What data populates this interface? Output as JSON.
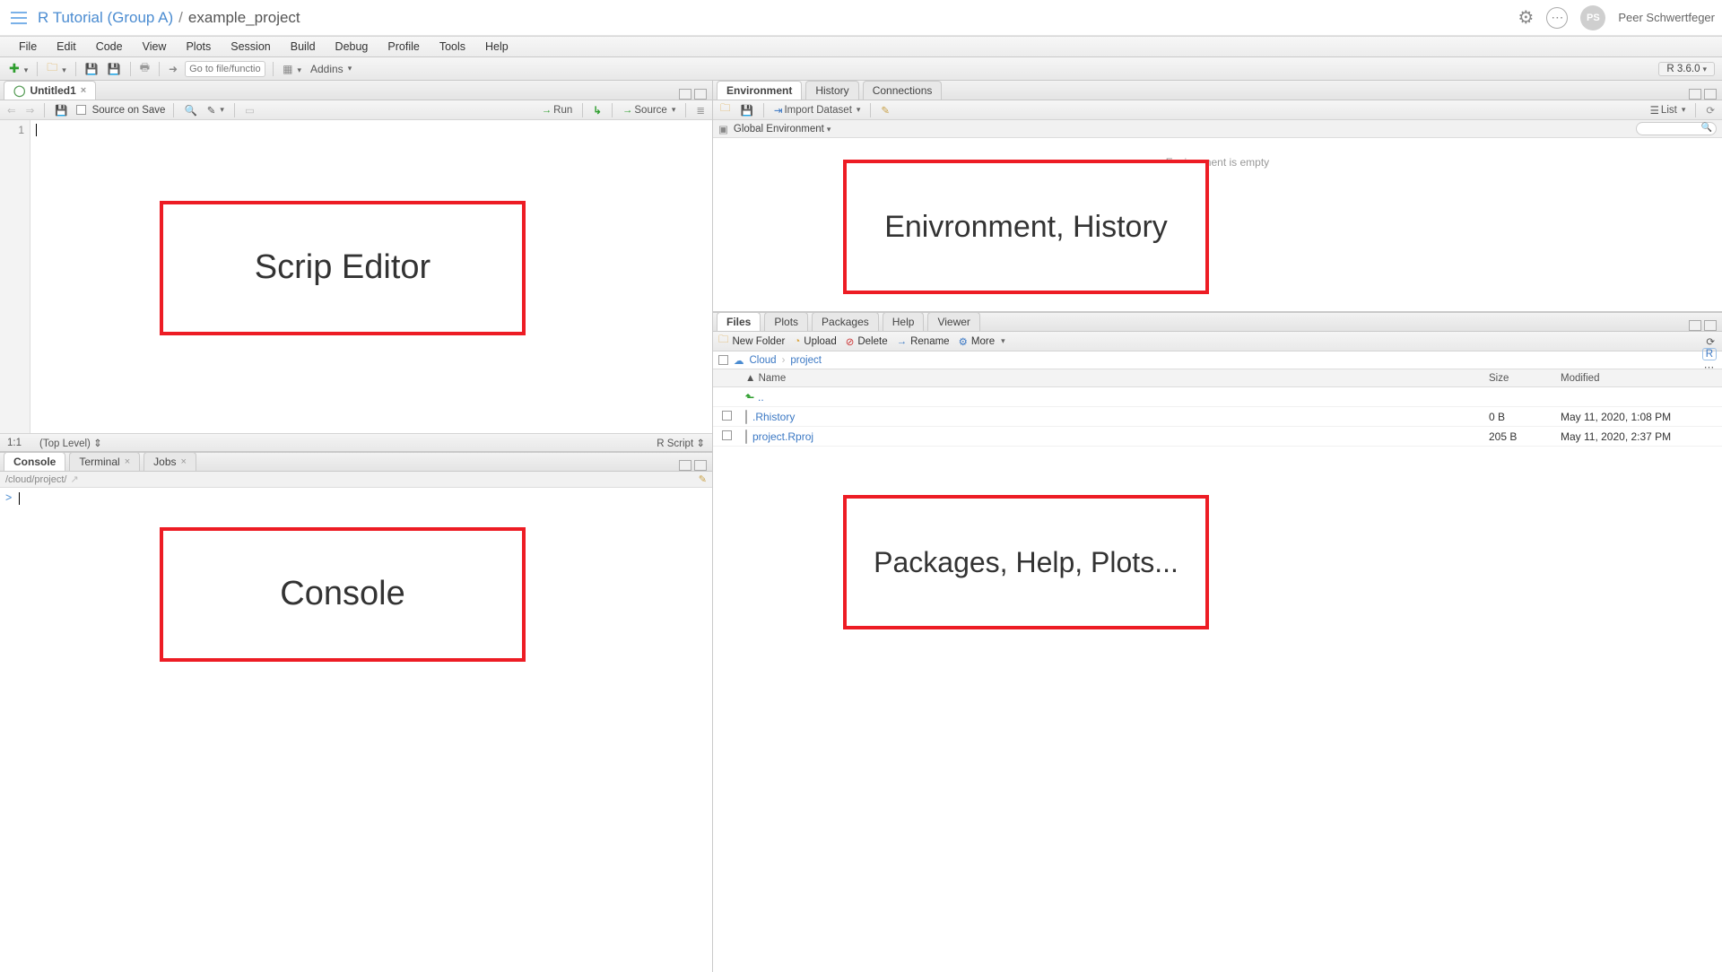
{
  "header": {
    "workspace_link": "R Tutorial (Group A)",
    "project_name": "example_project",
    "user_initials": "PS",
    "user_name": "Peer Schwertfeger"
  },
  "menus": [
    "File",
    "Edit",
    "Code",
    "View",
    "Plots",
    "Session",
    "Build",
    "Debug",
    "Profile",
    "Tools",
    "Help"
  ],
  "main_toolbar": {
    "go_placeholder": "Go to file/function",
    "addins_label": "Addins",
    "r_version": "R 3.6.0"
  },
  "editor": {
    "tab_title": "Untitled1",
    "source_on_save": "Source on Save",
    "run_label": "Run",
    "source_label": "Source",
    "line_number": "1",
    "cursor_pos": "1:1",
    "scope": "(Top Level)",
    "lang": "R Script",
    "annotation": "Scrip Editor"
  },
  "console": {
    "tabs": {
      "console": "Console",
      "terminal": "Terminal",
      "jobs": "Jobs"
    },
    "path": "/cloud/project/",
    "prompt": ">",
    "annotation": "Console"
  },
  "env": {
    "tabs": {
      "environment": "Environment",
      "history": "History",
      "connections": "Connections"
    },
    "import_label": "Import Dataset",
    "list_label": "List",
    "scope": "Global Environment",
    "empty_msg": "Environment is empty",
    "annotation": "Enivronment, History"
  },
  "files": {
    "tabs": {
      "files": "Files",
      "plots": "Plots",
      "packages": "Packages",
      "help": "Help",
      "viewer": "Viewer"
    },
    "buttons": {
      "new_folder": "New Folder",
      "upload": "Upload",
      "delete": "Delete",
      "rename": "Rename",
      "more": "More"
    },
    "crumb_root": "Cloud",
    "crumb_cur": "project",
    "cols": {
      "name": "Name",
      "size": "Size",
      "modified": "Modified"
    },
    "up": "..",
    "rows": [
      {
        "name": ".Rhistory",
        "size": "0 B",
        "modified": "May 11, 2020, 1:08 PM"
      },
      {
        "name": "project.Rproj",
        "size": "205 B",
        "modified": "May 11, 2020, 2:37 PM"
      }
    ],
    "annotation": "Packages, Help, Plots..."
  }
}
